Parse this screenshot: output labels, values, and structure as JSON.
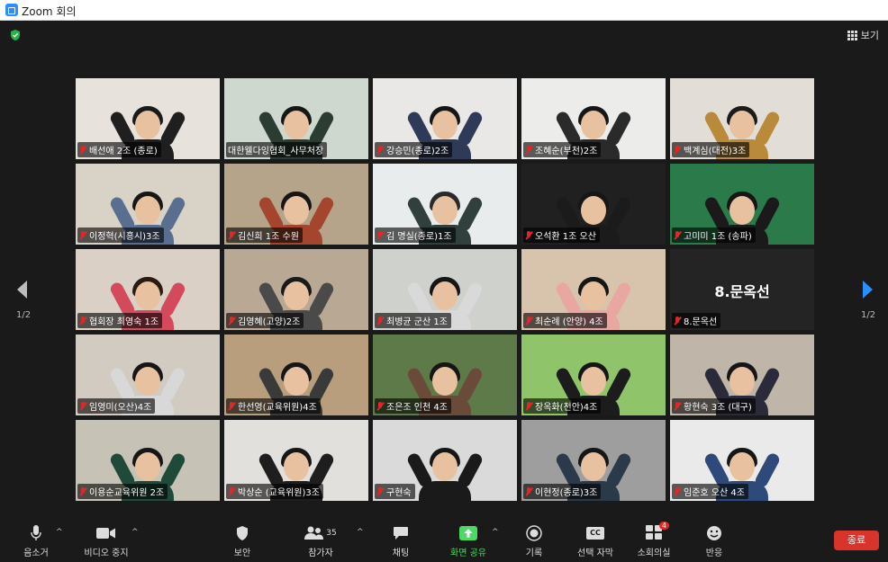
{
  "window": {
    "title": "Zoom 회의"
  },
  "topbar": {
    "view_label": "보기"
  },
  "pager": {
    "left": "1/2",
    "right": "1/2"
  },
  "participants": [
    {
      "name": "배선애 2조 (종로)",
      "bg": "#e8e2dc",
      "shirt": "#1f1f1f",
      "hair": "#1a1a1a"
    },
    {
      "name": "대한웰다잉협회_사무처장",
      "bg": "#cfd8cf",
      "shirt": "#2b3d33",
      "hair": "#161616"
    },
    {
      "name": "강승민(종로)2조",
      "bg": "#e9e8e6",
      "shirt": "#2f3a58",
      "hair": "#161616"
    },
    {
      "name": "조혜순(부천)2조",
      "bg": "#ececea",
      "shirt": "#2a2a2a",
      "hair": "#161616"
    },
    {
      "name": "백계심(대전)3조",
      "bg": "#e2ddd6",
      "shirt": "#b88a3a",
      "hair": "#1b1b1b"
    },
    {
      "name": "이정혁(시흥시)3조",
      "bg": "#d9d2c6",
      "shirt": "#5a6f8f",
      "hair": "#161616"
    },
    {
      "name": "김신희 1조 수원",
      "bg": "#b5a48a",
      "shirt": "#a4452e",
      "hair": "#161616"
    },
    {
      "name": "김 명실(종로)1조",
      "bg": "#e9ecec",
      "shirt": "#31403d",
      "hair": "#2a2a2a"
    },
    {
      "name": "오석환 1조 오산",
      "bg": "#202020",
      "shirt": "#1b1b1b",
      "hair": "#161616"
    },
    {
      "name": "고미미 1조 (송파)",
      "bg": "#2a7a4a",
      "shirt": "#1a1a1a",
      "hair": "#161616"
    },
    {
      "name": "협회장 최영숙 1조",
      "bg": "#dbd0c6",
      "shirt": "#d24a5c",
      "hair": "#2a1a12"
    },
    {
      "name": "김영혜(고양)2조",
      "bg": "#b9a994",
      "shirt": "#4a4a4a",
      "hair": "#1a1a1a"
    },
    {
      "name": "최병균 군산 1조",
      "bg": "#cfd2cc",
      "shirt": "#d9d9d9",
      "hair": "#161616"
    },
    {
      "name": "최순례 (안양) 4조",
      "bg": "#d8c3ac",
      "shirt": "#e8a7a0",
      "hair": "#161616"
    },
    {
      "name": "8.문옥선",
      "bg": "#242424",
      "shirt": "",
      "hair": ""
    },
    {
      "name": "임영미(오산)4조",
      "bg": "#d2cbc1",
      "shirt": "#d8d8d8",
      "hair": "#161616"
    },
    {
      "name": "한선영(교육위원)4조",
      "bg": "#b89e7d",
      "shirt": "#3a3a3a",
      "hair": "#161616"
    },
    {
      "name": "조은조 인천 4조",
      "bg": "#5d7a48",
      "shirt": "#6a4a38",
      "hair": "#161616"
    },
    {
      "name": "장옥화(천안)4조",
      "bg": "#8fc46a",
      "shirt": "#1c1c1c",
      "hair": "#161616"
    },
    {
      "name": "황현숙 3조 (대구)",
      "bg": "#bfb5a8",
      "shirt": "#2a2a3a",
      "hair": "#161616"
    },
    {
      "name": "이용순교육위원 2조",
      "bg": "#c6c2b6",
      "shirt": "#1f4a3a",
      "hair": "#161616"
    },
    {
      "name": "박상순 (교육위원)3조",
      "bg": "#e2e0dc",
      "shirt": "#1e1e1e",
      "hair": "#161616"
    },
    {
      "name": "구현숙",
      "bg": "#dadada",
      "shirt": "#1a1a1a",
      "hair": "#161616"
    },
    {
      "name": "이현정(종로)3조",
      "bg": "#9e9e9e",
      "shirt": "#2b3a4a",
      "hair": "#161616"
    },
    {
      "name": "임준호 오산 4조",
      "bg": "#eaeaea",
      "shirt": "#2e4a7a",
      "hair": "#161616"
    }
  ],
  "tile_8_big_label": "8.문옥선",
  "toolbar": {
    "mute": "음소거",
    "video": "비디오 중지",
    "security": "보안",
    "participants": "참가자",
    "participants_count": "35",
    "chat": "채팅",
    "share": "화면 공유",
    "record": "기록",
    "captions": "선택 자막",
    "captions_icon": "CC",
    "breakout": "소회의실",
    "breakout_badge": "4",
    "reactions": "반응",
    "end": "종료"
  },
  "colors": {
    "active_border": "#c9e25a",
    "end": "#d9342b",
    "share": "#4cd964",
    "nav_arrow": "#2d8cff"
  }
}
